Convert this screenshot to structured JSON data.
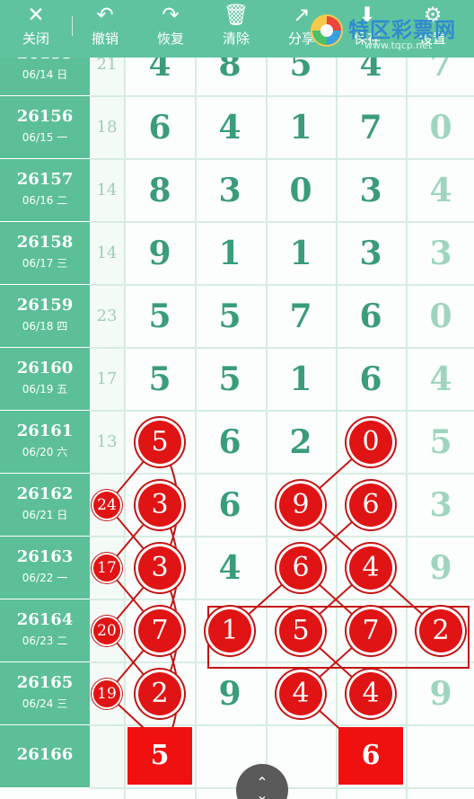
{
  "toolbar": {
    "items": [
      {
        "label": "关闭",
        "icon": "close-icon",
        "glyph": "✕"
      },
      {
        "label": "撤销",
        "icon": "undo-icon",
        "glyph": "↶"
      },
      {
        "label": "恢复",
        "icon": "redo-icon",
        "glyph": "↷"
      },
      {
        "label": "清除",
        "icon": "trash-icon",
        "glyph": "🗑"
      },
      {
        "label": "分享",
        "icon": "share-icon",
        "glyph": "↗"
      },
      {
        "label": "保存",
        "icon": "download-icon",
        "glyph": "⬇"
      },
      {
        "label": "设置",
        "icon": "settings-icon",
        "glyph": "⚙"
      }
    ]
  },
  "brand": {
    "title": "特区彩票网",
    "url": "www.tqcp.net"
  },
  "colors": {
    "header": "#5fc3a0",
    "ball": "#e01414",
    "digit": "#3a9c7a"
  },
  "rows": [
    {
      "issue": "26155",
      "date": "06/14 日",
      "sum": "21",
      "digits": [
        "4",
        "8",
        "5",
        "4",
        "7"
      ]
    },
    {
      "issue": "26156",
      "date": "06/15 一",
      "sum": "18",
      "digits": [
        "6",
        "4",
        "1",
        "7",
        "0"
      ]
    },
    {
      "issue": "26157",
      "date": "06/16 二",
      "sum": "14",
      "digits": [
        "8",
        "3",
        "0",
        "3",
        "4"
      ]
    },
    {
      "issue": "26158",
      "date": "06/17 三",
      "sum": "14",
      "digits": [
        "9",
        "1",
        "1",
        "3",
        "3"
      ]
    },
    {
      "issue": "26159",
      "date": "06/18 四",
      "sum": "23",
      "digits": [
        "5",
        "5",
        "7",
        "6",
        "0"
      ]
    },
    {
      "issue": "26160",
      "date": "06/19 五",
      "sum": "17",
      "digits": [
        "5",
        "5",
        "1",
        "6",
        "4"
      ]
    },
    {
      "issue": "26161",
      "date": "06/20 六",
      "sum": "13",
      "digits": [
        "5",
        "6",
        "2",
        "0",
        "5"
      ]
    },
    {
      "issue": "26162",
      "date": "06/21 日",
      "sum": "24",
      "digits": [
        "3",
        "6",
        "9",
        "6",
        "3"
      ]
    },
    {
      "issue": "26163",
      "date": "06/22 一",
      "sum": "17",
      "digits": [
        "3",
        "4",
        "6",
        "4",
        "9"
      ]
    },
    {
      "issue": "26164",
      "date": "06/23 二",
      "sum": "20",
      "digits": [
        "7",
        "1",
        "5",
        "7",
        "2"
      ]
    },
    {
      "issue": "26165",
      "date": "06/24 三",
      "sum": "19",
      "digits": [
        "2",
        "9",
        "4",
        "4",
        "9"
      ]
    },
    {
      "issue": "26166",
      "date": "",
      "sum": "",
      "digits": [
        "5",
        "",
        "",
        "6",
        ""
      ]
    }
  ],
  "circled": [
    [
      6,
      0
    ],
    [
      6,
      3
    ],
    [
      7,
      0
    ],
    [
      7,
      2
    ],
    [
      7,
      3
    ],
    [
      8,
      0
    ],
    [
      8,
      2
    ],
    [
      8,
      3
    ],
    [
      9,
      0
    ],
    [
      9,
      1
    ],
    [
      9,
      2
    ],
    [
      9,
      3
    ],
    [
      9,
      4
    ],
    [
      10,
      0
    ],
    [
      10,
      2
    ],
    [
      10,
      3
    ]
  ],
  "circled_sums": [
    7,
    8,
    9,
    10
  ],
  "predicted": [
    [
      11,
      0
    ],
    [
      11,
      3
    ]
  ],
  "scroll": {
    "icon": "scroll-updown-icon"
  }
}
